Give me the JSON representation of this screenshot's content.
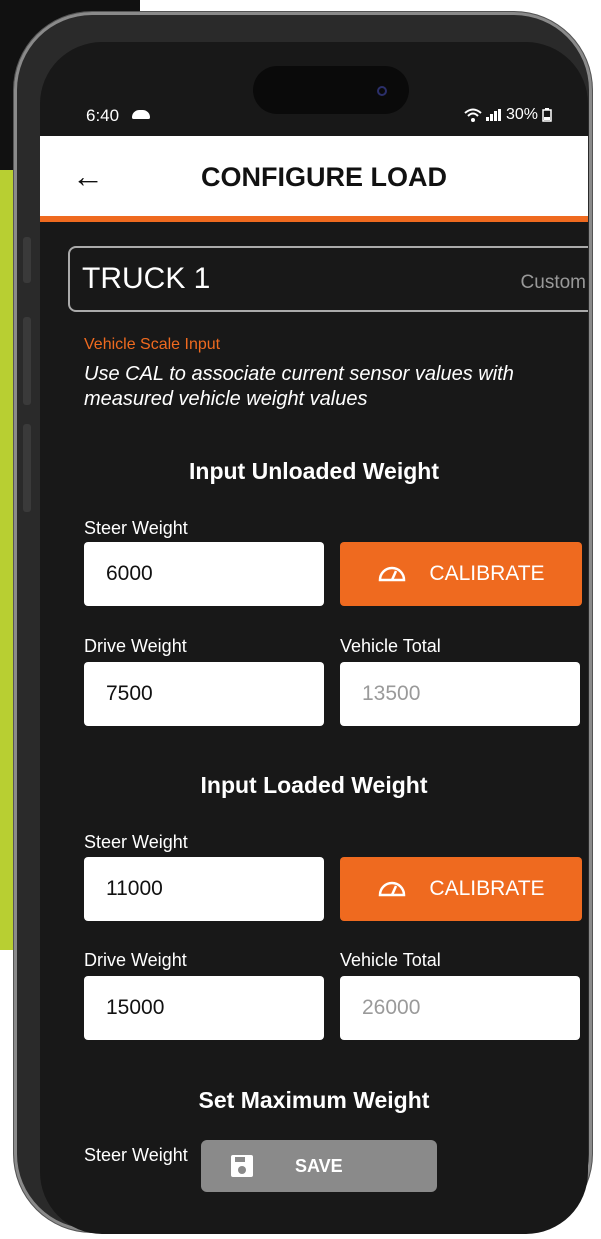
{
  "status": {
    "time": "6:40",
    "battery": "30%"
  },
  "header": {
    "title": "CONFIGURE LOAD"
  },
  "vehicle": {
    "name": "TRUCK 1",
    "type": "Custom"
  },
  "section": {
    "label": "Vehicle Scale Input",
    "description": "Use CAL to associate current sensor values with measured vehicle weight values"
  },
  "unloaded": {
    "heading": "Input Unloaded Weight",
    "steer_label": "Steer Weight",
    "steer_value": "6000",
    "calibrate_label": "CALIBRATE",
    "drive_label": "Drive Weight",
    "drive_value": "7500",
    "total_label": "Vehicle Total",
    "total_value": "13500"
  },
  "loaded": {
    "heading": "Input Loaded Weight",
    "steer_label": "Steer Weight",
    "steer_value": "11000",
    "calibrate_label": "CALIBRATE",
    "drive_label": "Drive Weight",
    "drive_value": "15000",
    "total_label": "Vehicle Total",
    "total_value": "26000"
  },
  "maximum": {
    "heading": "Set Maximum Weight",
    "steer_label": "Steer Weight"
  },
  "save_label": "SAVE",
  "colors": {
    "accent": "#ef6a1f",
    "background": "#181818",
    "disabled_button": "#8a8a8a"
  }
}
